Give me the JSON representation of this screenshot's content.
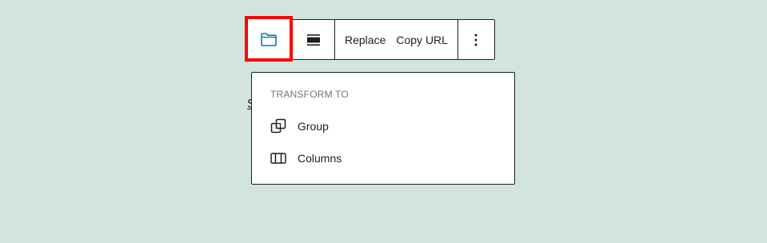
{
  "toolbar": {
    "block_icon": "folder-icon",
    "align_icon": "align-wide-icon",
    "replace_label": "Replace",
    "copy_url_label": "Copy URL",
    "more_icon": "more-vertical-icon",
    "highlight_color": "#ff0000",
    "block_icon_color": "#007cba"
  },
  "background": {
    "partial_text": "S"
  },
  "popover": {
    "heading": "TRANSFORM TO",
    "items": [
      {
        "label": "Group",
        "icon": "group-icon"
      },
      {
        "label": "Columns",
        "icon": "columns-icon"
      }
    ]
  }
}
